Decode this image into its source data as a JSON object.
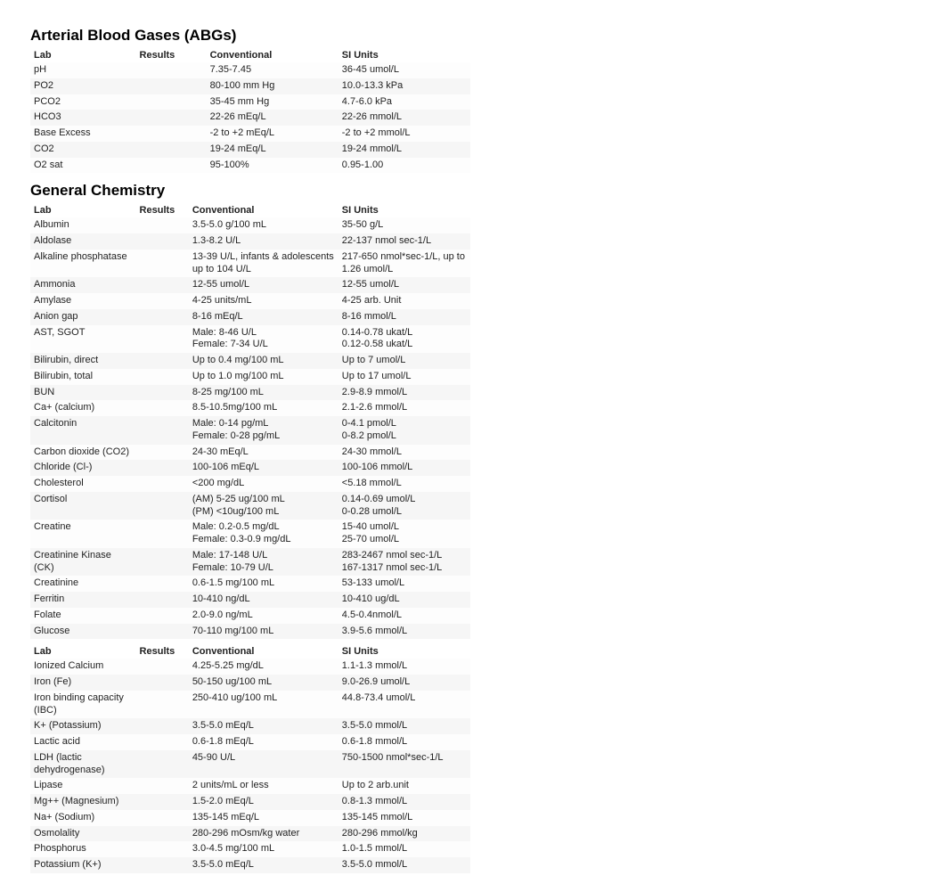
{
  "abg": {
    "title": "Arterial Blood Gases (ABGs)",
    "headers": {
      "lab": "Lab",
      "results": "Results",
      "conventional": "Conventional",
      "si": "SI Units"
    },
    "rows": [
      {
        "lab": "pH",
        "res": "",
        "conv": "7.35-7.45",
        "si": "36-45 umol/L"
      },
      {
        "lab": "PO2",
        "res": "",
        "conv": "80-100 mm Hg",
        "si": "10.0-13.3 kPa"
      },
      {
        "lab": "PCO2",
        "res": "",
        "conv": "35-45 mm Hg",
        "si": "4.7-6.0 kPa"
      },
      {
        "lab": "HCO3",
        "res": "",
        "conv": "22-26 mEq/L",
        "si": "22-26 mmol/L"
      },
      {
        "lab": "Base Excess",
        "res": "",
        "conv": "-2 to +2 mEq/L",
        "si": "-2 to +2 mmol/L"
      },
      {
        "lab": "CO2",
        "res": "",
        "conv": "19-24 mEq/L",
        "si": "19-24 mmol/L"
      },
      {
        "lab": "O2 sat",
        "res": "",
        "conv": "95-100%",
        "si": "0.95-1.00"
      }
    ]
  },
  "gc": {
    "title": "General Chemistry",
    "headers": {
      "lab": "Lab",
      "results": "Results",
      "conventional": "Conventional",
      "si": "SI Units"
    },
    "rows": [
      {
        "lab": "Albumin",
        "res": "",
        "conv": "3.5-5.0 g/100 mL",
        "si": "35-50 g/L"
      },
      {
        "lab": "Aldolase",
        "res": "",
        "conv": "1.3-8.2 U/L",
        "si": "22-137 nmol sec-1/L"
      },
      {
        "lab": "Alkaline phosphatase",
        "res": "",
        "conv": "13-39 U/L, infants & adolescents up to 104 U/L",
        "si": "217-650 nmol*sec-1/L, up to 1.26 umol/L"
      },
      {
        "lab": "Ammonia",
        "res": "",
        "conv": "12-55 umol/L",
        "si": "12-55 umol/L"
      },
      {
        "lab": "Amylase",
        "res": "",
        "conv": "4-25 units/mL",
        "si": "4-25 arb. Unit"
      },
      {
        "lab": "Anion gap",
        "res": "",
        "conv": "8-16 mEq/L",
        "si": "8-16 mmol/L"
      },
      {
        "lab": "AST, SGOT",
        "res": "",
        "conv": "Male: 8-46 U/L\nFemale: 7-34 U/L",
        "si": "0.14-0.78 ukat/L\n0.12-0.58 ukat/L"
      },
      {
        "lab": "Bilirubin, direct",
        "res": "",
        "conv": "Up to 0.4 mg/100 mL",
        "si": "Up to 7 umol/L"
      },
      {
        "lab": "Bilirubin, total",
        "res": "",
        "conv": "Up to 1.0 mg/100 mL",
        "si": "Up to 17 umol/L"
      },
      {
        "lab": "BUN",
        "res": "",
        "conv": "8-25 mg/100 mL",
        "si": "2.9-8.9 mmol/L"
      },
      {
        "lab": "Ca+ (calcium)",
        "res": "",
        "conv": "8.5-10.5mg/100 mL",
        "si": "2.1-2.6 mmol/L"
      },
      {
        "lab": "Calcitonin",
        "res": "",
        "conv": "Male: 0-14 pg/mL\nFemale: 0-28 pg/mL",
        "si": "0-4.1 pmol/L\n0-8.2 pmol/L"
      },
      {
        "lab": "Carbon dioxide (CO2)",
        "res": "",
        "conv": "24-30 mEq/L",
        "si": "24-30 mmol/L"
      },
      {
        "lab": "Chloride (Cl-)",
        "res": "",
        "conv": "100-106 mEq/L",
        "si": "100-106 mmol/L"
      },
      {
        "lab": "Cholesterol",
        "res": "",
        "conv": "<200 mg/dL",
        "si": "<5.18 mmol/L"
      },
      {
        "lab": "Cortisol",
        "res": "",
        "conv": "(AM) 5-25 ug/100 mL\n(PM) <10ug/100 mL",
        "si": "0.14-0.69 umol/L\n0-0.28 umol/L"
      },
      {
        "lab": "Creatine",
        "res": "",
        "conv": "Male: 0.2-0.5 mg/dL\nFemale: 0.3-0.9 mg/dL",
        "si": "15-40 umol/L\n25-70 umol/L"
      },
      {
        "lab": "Creatinine Kinase (CK)",
        "res": "",
        "conv": "Male: 17-148 U/L\nFemale: 10-79 U/L",
        "si": "283-2467 nmol sec-1/L\n167-1317 nmol sec-1/L"
      },
      {
        "lab": "Creatinine",
        "res": "",
        "conv": "0.6-1.5 mg/100 mL",
        "si": "53-133 umol/L"
      },
      {
        "lab": "Ferritin",
        "res": "",
        "conv": "10-410 ng/dL",
        "si": "10-410 ug/dL"
      },
      {
        "lab": "Folate",
        "res": "",
        "conv": "2.0-9.0 ng/mL",
        "si": "4.5-0.4nmol/L"
      },
      {
        "lab": "Glucose",
        "res": "",
        "conv": "70-110 mg/100 mL",
        "si": "3.9-5.6 mmol/L"
      }
    ]
  },
  "gcCont": {
    "headers": {
      "lab": "Lab",
      "results": "Results",
      "conventional": "Conventional",
      "si": "SI Units"
    },
    "rows": [
      {
        "lab": "Ionized Calcium",
        "res": "",
        "conv": "4.25-5.25 mg/dL",
        "si": "1.1-1.3 mmol/L"
      },
      {
        "lab": "Iron (Fe)",
        "res": "",
        "conv": "50-150 ug/100 mL",
        "si": "9.0-26.9 umol/L"
      },
      {
        "lab": "Iron binding capacity (IBC)",
        "res": "",
        "conv": "250-410 ug/100 mL",
        "si": "44.8-73.4 umol/L"
      },
      {
        "lab": "K+ (Potassium)",
        "res": "",
        "conv": "3.5-5.0 mEq/L",
        "si": "3.5-5.0 mmol/L"
      },
      {
        "lab": "Lactic acid",
        "res": "",
        "conv": "0.6-1.8 mEq/L",
        "si": "0.6-1.8 mmol/L"
      },
      {
        "lab": "LDH (lactic dehydrogenase)",
        "res": "",
        "conv": "45-90 U/L",
        "si": "750-1500 nmol*sec-1/L"
      },
      {
        "lab": "Lipase",
        "res": "",
        "conv": "2 units/mL or less",
        "si": "Up to 2 arb.unit"
      },
      {
        "lab": "Mg++ (Magnesium)",
        "res": "",
        "conv": "1.5-2.0 mEq/L",
        "si": "0.8-1.3 mmol/L"
      },
      {
        "lab": "Na+ (Sodium)",
        "res": "",
        "conv": "135-145 mEq/L",
        "si": "135-145 mmol/L"
      },
      {
        "lab": "Osmolality",
        "res": "",
        "conv": "280-296 mOsm/kg water",
        "si": "280-296 mmol/kg"
      },
      {
        "lab": "Phosphorus",
        "res": "",
        "conv": "3.0-4.5 mg/100 mL",
        "si": "1.0-1.5 mmol/L"
      },
      {
        "lab": "Potassium (K+)",
        "res": "",
        "conv": "3.5-5.0 mEq/L",
        "si": "3.5-5.0 mmol/L"
      }
    ]
  }
}
